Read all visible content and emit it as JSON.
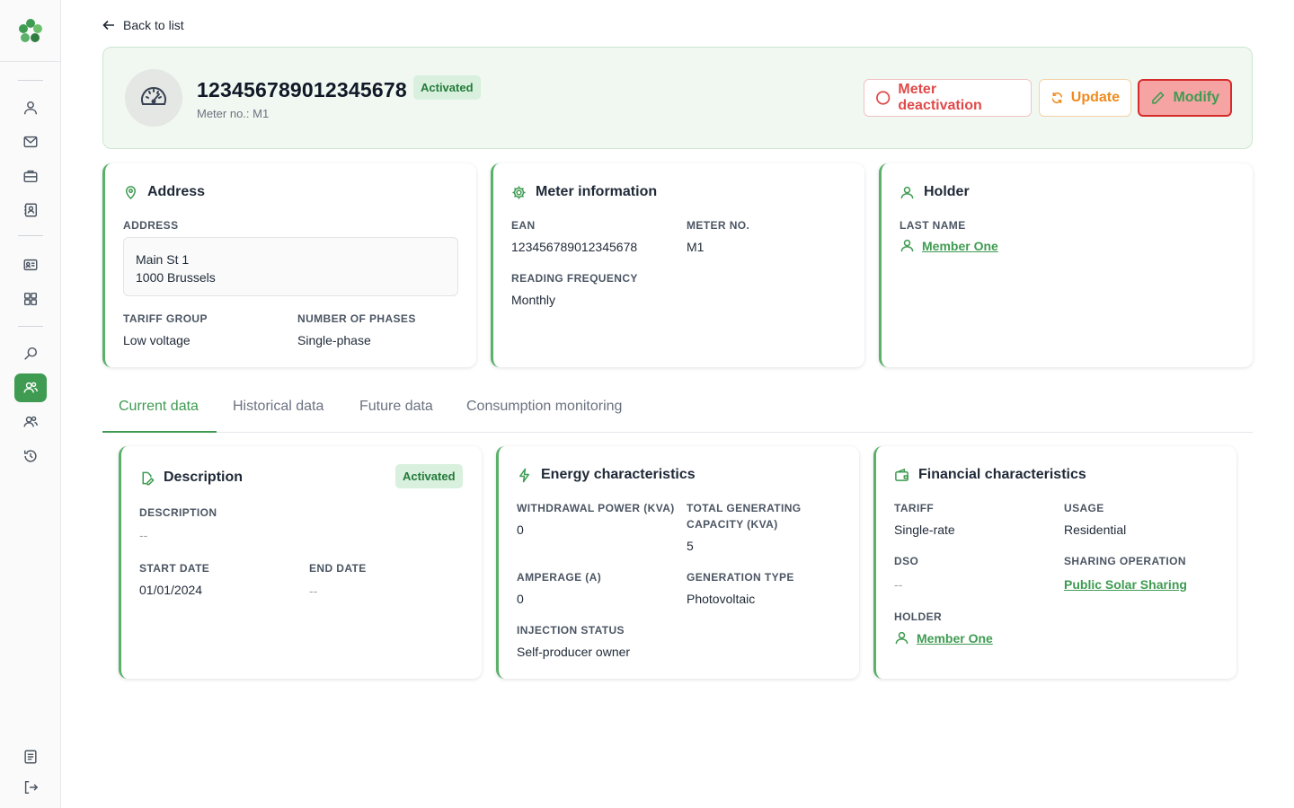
{
  "sidebar": {
    "items": [
      "member",
      "mail",
      "briefcase",
      "contacts",
      "id-card",
      "grid",
      "search",
      "members-active",
      "members",
      "history",
      "document",
      "logout"
    ]
  },
  "nav": {
    "back_label": "Back to list"
  },
  "header": {
    "ean": "123456789012345678",
    "status": "Activated",
    "meter_no": "Meter no.: M1",
    "buttons": {
      "deactivate": "Meter deactivation",
      "update": "Update",
      "modify": "Modify"
    }
  },
  "address_card": {
    "title": "Address",
    "address_label": "ADDRESS",
    "address_line1": "Main St 1",
    "address_line2": "1000 Brussels",
    "tariff_group_label": "TARIFF GROUP",
    "tariff_group": "Low voltage",
    "phases_label": "NUMBER OF PHASES",
    "phases": "Single-phase"
  },
  "meter_card": {
    "title": "Meter information",
    "ean_label": "EAN",
    "ean": "123456789012345678",
    "meter_no_label": "METER NO.",
    "meter_no": "M1",
    "frequency_label": "READING FREQUENCY",
    "frequency": "Monthly"
  },
  "holder_card": {
    "title": "Holder",
    "last_name_label": "LAST NAME",
    "holder_name": "Member One"
  },
  "tabs": [
    "Current data",
    "Historical data",
    "Future data",
    "Consumption monitoring"
  ],
  "description_card": {
    "title": "Description",
    "status": "Activated",
    "description_label": "DESCRIPTION",
    "description": "--",
    "start_label": "START DATE",
    "start": "01/01/2024",
    "end_label": "END DATE",
    "end": "--"
  },
  "energy_card": {
    "title": "Energy characteristics",
    "withdrawal_label": "WITHDRAWAL POWER (KVA)",
    "withdrawal": "0",
    "generating_label_1": "TOTAL GENERATING",
    "generating_label_2": "CAPACITY (KVA)",
    "generating": "5",
    "amperage_label": "AMPERAGE (A)",
    "amperage": "0",
    "gen_type_label": "GENERATION TYPE",
    "gen_type": "Photovoltaic",
    "injection_label": "INJECTION STATUS",
    "injection": "Self-producer owner"
  },
  "financial_card": {
    "title": "Financial characteristics",
    "tariff_label": "TARIFF",
    "tariff": "Single-rate",
    "usage_label": "USAGE",
    "usage": "Residential",
    "dso_label": "DSO",
    "dso": "--",
    "sharing_label": "SHARING OPERATION",
    "sharing": "Public Solar Sharing",
    "holder_label": "HOLDER",
    "holder": "Member One"
  },
  "colors": {
    "accent": "#3f9b52",
    "danger": "#e04a4a",
    "warning": "#f08a1e",
    "badge_bg": "#d8f0dd"
  }
}
